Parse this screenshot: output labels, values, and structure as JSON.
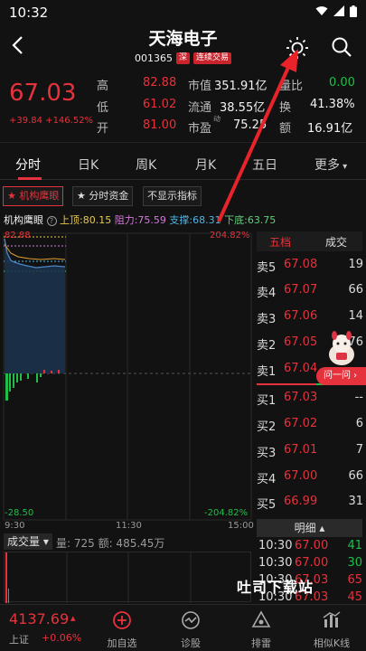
{
  "status": {
    "time": "10:32"
  },
  "header": {
    "name": "天海电子",
    "code": "001365",
    "tag_market": "深",
    "tag_trading": "连续交易"
  },
  "quote": {
    "price": "67.03",
    "change": "+39.84 +146.52%",
    "rows": [
      {
        "l1": "高",
        "v1": "82.88",
        "l2": "市值",
        "v2": "351.91亿",
        "l3": "量比",
        "v3": "0.00"
      },
      {
        "l1": "低",
        "v1": "61.02",
        "l2": "流通",
        "v2": "38.55亿",
        "l3": "换",
        "v3": "41.38%"
      },
      {
        "l1": "开",
        "v1": "81.00",
        "l2": "市盈",
        "l2sup": "动",
        "v2": "75.25",
        "l3": "额",
        "v3": "16.91亿"
      }
    ]
  },
  "tabs": [
    "分时",
    "日K",
    "周K",
    "月K",
    "五日",
    "更多"
  ],
  "chips": [
    "机构鹰眼",
    "分时资金",
    "不显示指标"
  ],
  "indicator": {
    "name": "机构鹰眼",
    "top": "上顶:80.15",
    "resist": "阻力:75.59",
    "support": "支撑:68.31",
    "bottom": "下底:63.75"
  },
  "chart": {
    "y_high": "82.88",
    "y_low": "-28.50",
    "pct_high": "204.82%",
    "pct_low": "-204.82%",
    "x_start": "9:30",
    "x_mid": "11:30",
    "x_end": "15:00"
  },
  "book": {
    "tab_five": "五档",
    "tab_trades": "成交",
    "sells": [
      {
        "label": "卖5",
        "price": "67.08",
        "vol": "19"
      },
      {
        "label": "卖4",
        "price": "67.07",
        "vol": "66"
      },
      {
        "label": "卖3",
        "price": "67.06",
        "vol": "14"
      },
      {
        "label": "卖2",
        "price": "67.05",
        "vol": "76"
      },
      {
        "label": "卖1",
        "price": "67.04",
        "vol": ""
      }
    ],
    "buys": [
      {
        "label": "买1",
        "price": "67.03",
        "vol": "--"
      },
      {
        "label": "买2",
        "price": "67.02",
        "vol": "6"
      },
      {
        "label": "买3",
        "price": "67.01",
        "vol": "7"
      },
      {
        "label": "买4",
        "price": "67.00",
        "vol": "66"
      },
      {
        "label": "买5",
        "price": "66.99",
        "vol": "31"
      }
    ],
    "ask_label": "问一问 ›"
  },
  "detail": {
    "head": "明细 ▴",
    "trades": [
      {
        "time": "10:30",
        "price": "67.00",
        "vol": "41"
      },
      {
        "time": "10:30",
        "price": "67.00",
        "vol": "30"
      },
      {
        "time": "10:30",
        "price": "67.03",
        "vol": "65"
      },
      {
        "time": "10:30",
        "price": "67.03",
        "vol": "45"
      }
    ]
  },
  "volume": {
    "chip": "成交量 ▾",
    "info": "量: 725  额: 485.45万"
  },
  "bottom": {
    "index_value": "4137.69",
    "index_arrow": "▴",
    "index_name": "上证",
    "index_pct": "+0.06%",
    "nav": [
      "加自选",
      "诊股",
      "排雷",
      "相似K线"
    ]
  },
  "watermark": "吐司下载站"
}
